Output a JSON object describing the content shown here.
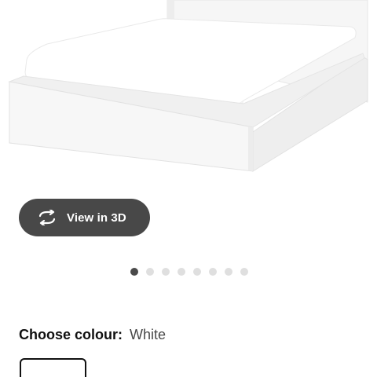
{
  "product_image": {
    "alt": "White bed frame with mattress",
    "colors": {
      "frame": "#f4f4f4",
      "mattress": "#ffffff",
      "shadow": "#e3e3e3"
    }
  },
  "view3d": {
    "label": "View in 3D",
    "icon": "rotate-3d-icon",
    "background": "#484848"
  },
  "carousel": {
    "dot_count": 8,
    "active_index": 0
  },
  "colour": {
    "label": "Choose colour:",
    "value": "White"
  }
}
